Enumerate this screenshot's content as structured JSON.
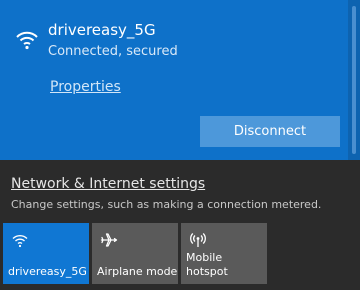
{
  "network": {
    "name": "drivereasy_5G",
    "status": "Connected, secured",
    "properties_label": "Properties",
    "disconnect_label": "Disconnect"
  },
  "settings": {
    "link_label": "Network & Internet settings",
    "description": "Change settings, such as making a connection metered."
  },
  "tiles": [
    {
      "label": "drivereasy_5G",
      "icon": "wifi-icon",
      "active": true
    },
    {
      "label": "Airplane mode",
      "icon": "airplane-icon",
      "active": false
    },
    {
      "label": "Mobile\nhotspot",
      "icon": "hotspot-icon",
      "active": false
    }
  ],
  "colors": {
    "accent": "#0e71c9",
    "active_tile": "#1077d3",
    "tile": "#5a5a5a",
    "button": "#4d98da",
    "background": "#2b2b2b"
  }
}
